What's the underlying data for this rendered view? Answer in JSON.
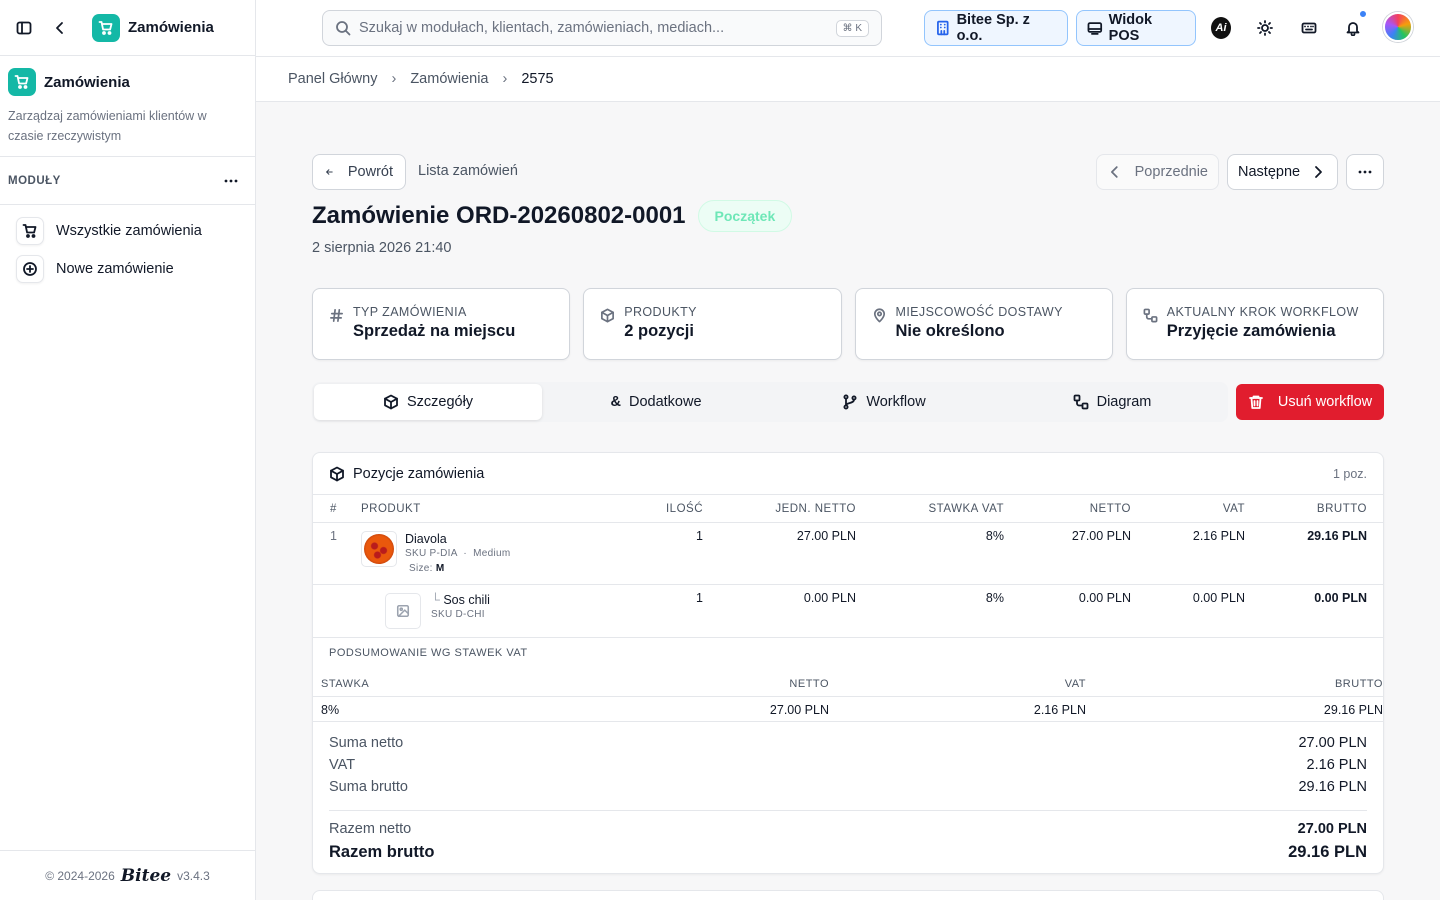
{
  "sidebar": {
    "app_title": "Zamówienia",
    "module_name": "Zamówienia",
    "module_desc": "Zarządzaj zamówieniami klientów w czasie rzeczywistym",
    "section_label": "MODUŁY",
    "items": [
      {
        "label": "Wszystkie zamówienia",
        "icon": "cart-icon"
      },
      {
        "label": "Nowe zamówienie",
        "icon": "plus-circle-icon"
      }
    ],
    "footer_copy": "© 2024-2026",
    "footer_brand": "Bitee",
    "footer_version": "v3.4.3"
  },
  "topbar": {
    "search_placeholder": "Szukaj w modułach, klientach, zamówieniach, mediach...",
    "search_shortcut": "⌘ K",
    "company": "Bitee Sp. z o.o.",
    "pos": "Widok POS",
    "ai_label": "Ai"
  },
  "breadcrumb": [
    "Panel Główny",
    "Zamówienia",
    "2575"
  ],
  "nav": {
    "back": "Powrót",
    "list": "Lista zamówień",
    "prev": "Poprzednie",
    "next": "Następne"
  },
  "order": {
    "title": "Zamówienie ORD-20260802-0001",
    "status": "Początek",
    "date": "2 sierpnia 2026 21:40"
  },
  "cards": [
    {
      "key": "TYP ZAMÓWIENIA",
      "value": "Sprzedaż na miejscu"
    },
    {
      "key": "PRODUKTY",
      "value": "2 pozycji"
    },
    {
      "key": "MIEJSCOWOŚĆ DOSTAWY",
      "value": "Nie określono"
    },
    {
      "key": "AKTUALNY KROK WORKFLOW",
      "value": "Przyjęcie zamówienia"
    }
  ],
  "tabs": [
    "Szczegóły",
    "Dodatkowe",
    "Workflow",
    "Diagram"
  ],
  "delete_label": "Usuń workflow",
  "items_panel": {
    "title": "Pozycje zamówienia",
    "count": "1 poz.",
    "columns": [
      "#",
      "PRODUKT",
      "ILOŚĆ",
      "JEDN. NETTO",
      "STAWKA VAT",
      "NETTO",
      "VAT",
      "BRUTTO"
    ],
    "rows": [
      {
        "num": "1",
        "name": "Diavola",
        "sku": "SKU P-DIA",
        "variant": "Medium",
        "opt_key": "Size:",
        "opt_val": "M",
        "qty": "1",
        "unit": "27.00 PLN",
        "rate": "8%",
        "net": "27.00 PLN",
        "vat": "2.16 PLN",
        "gross": "29.16 PLN"
      },
      {
        "num": "",
        "prefix": "└",
        "name": "Sos chili",
        "sku": "SKU D-CHI",
        "qty": "1",
        "unit": "0.00 PLN",
        "rate": "8%",
        "net": "0.00 PLN",
        "vat": "0.00 PLN",
        "gross": "0.00 PLN"
      }
    ],
    "vat_title": "PODSUMOWANIE WG STAWEK VAT",
    "vat_columns": [
      "STAWKA",
      "NETTO",
      "VAT",
      "BRUTTO"
    ],
    "vat_rows": [
      [
        "8%",
        "27.00 PLN",
        "2.16 PLN",
        "29.16 PLN"
      ]
    ],
    "sums": [
      {
        "label": "Suma netto",
        "value": "27.00 PLN"
      },
      {
        "label": "VAT",
        "value": "2.16 PLN"
      },
      {
        "label": "Suma brutto",
        "value": "29.16 PLN"
      }
    ],
    "total_net_label": "Razem netto",
    "total_net": "27.00 PLN",
    "total_gross_label": "Razem brutto",
    "total_gross": "29.16 PLN"
  },
  "colors": {
    "accent": "#14b8a6",
    "danger": "#e11d2e",
    "status_bg": "#ecfdf5"
  }
}
